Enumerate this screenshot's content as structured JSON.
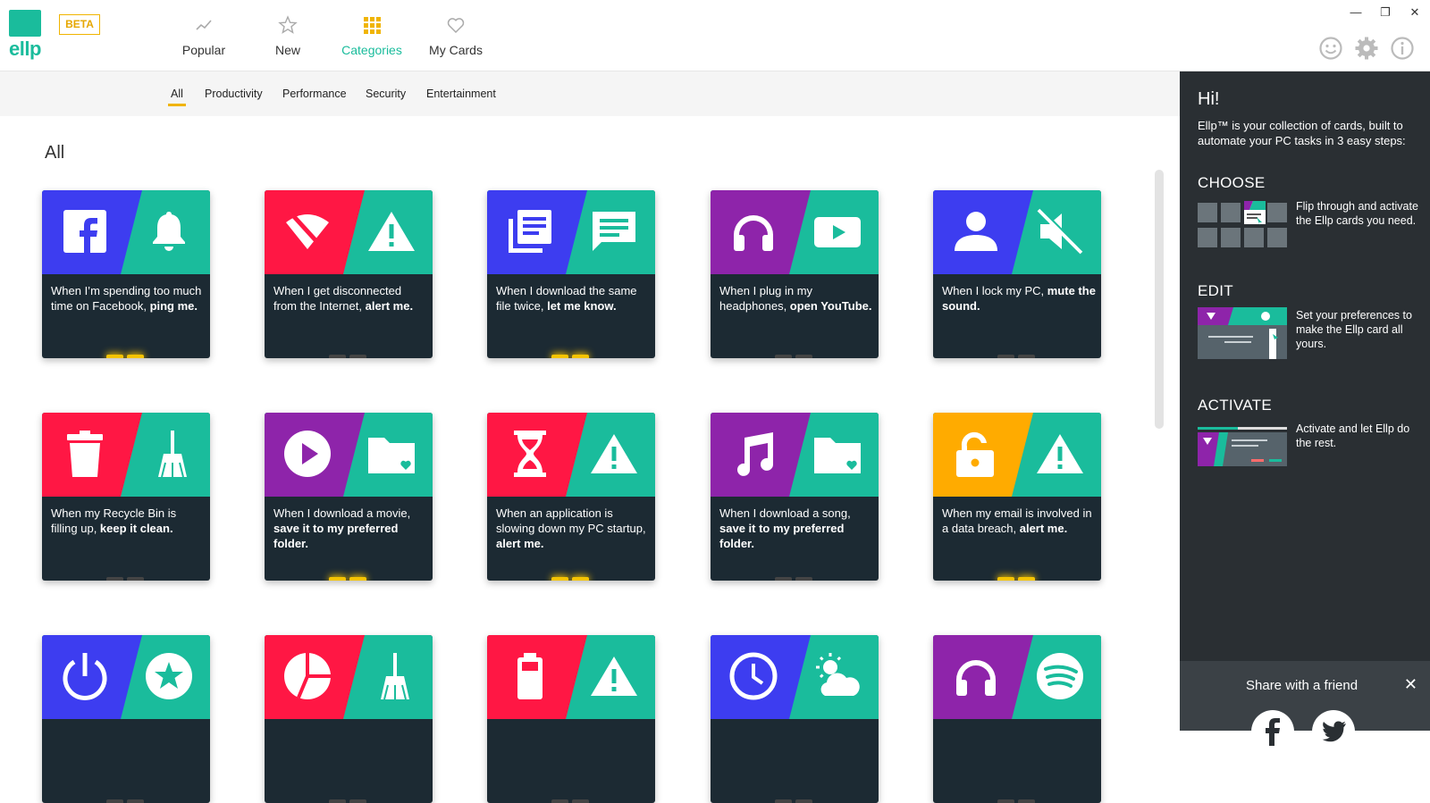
{
  "app": {
    "logo_text": "ellp",
    "beta_label": "BETA"
  },
  "nav": {
    "items": [
      {
        "label": "Popular",
        "icon": "trend-icon"
      },
      {
        "label": "New",
        "icon": "star-icon"
      },
      {
        "label": "Categories",
        "icon": "grid-icon",
        "active": true
      },
      {
        "label": "My Cards",
        "icon": "heart-icon"
      }
    ]
  },
  "window_controls": [
    "minimize",
    "restore",
    "close"
  ],
  "top_icons": [
    "smiley-icon",
    "gear-icon",
    "info-icon"
  ],
  "subnav": {
    "items": [
      {
        "label": "All",
        "active": true
      },
      {
        "label": "Productivity"
      },
      {
        "label": "Performance"
      },
      {
        "label": "Security"
      },
      {
        "label": "Entertainment"
      }
    ]
  },
  "section_title": "All",
  "colors": {
    "teal": "#1abc9c",
    "blue": "#3d3df0",
    "red": "#ff1744",
    "purple": "#8e24aa",
    "orange": "#ffab00",
    "card_dark": "#1c2a33",
    "yellow": "#f5c400"
  },
  "cards": [
    {
      "left_color": "#3d3df0",
      "left_icon": "facebook-icon",
      "right_icon": "bell-icon",
      "text_plain": "When I’m spending too much time on Facebook, ",
      "text_bold": "ping me.",
      "toggle_on": true
    },
    {
      "left_color": "#ff1744",
      "left_icon": "no-wifi-icon",
      "right_icon": "warning-icon",
      "text_plain": "When I get disconnected from the Internet, ",
      "text_bold": "alert me.",
      "toggle_on": false
    },
    {
      "left_color": "#3d3df0",
      "left_icon": "documents-icon",
      "right_icon": "message-icon",
      "text_plain": "When I download the same file twice, ",
      "text_bold": "let me know.",
      "toggle_on": true
    },
    {
      "left_color": "#8e24aa",
      "left_icon": "headphones-icon",
      "right_icon": "youtube-icon",
      "text_plain": "When I plug in my headphones, ",
      "text_bold": "open YouTube.",
      "toggle_on": false
    },
    {
      "left_color": "#3d3df0",
      "left_icon": "user-icon",
      "right_icon": "mute-icon",
      "text_plain": "When I lock my PC, ",
      "text_bold": "mute the sound.",
      "toggle_on": false
    },
    {
      "left_color": "#ff1744",
      "left_icon": "trash-icon",
      "right_icon": "broom-icon",
      "text_plain": "When my Recycle Bin is filling up, ",
      "text_bold": "keep it clean.",
      "toggle_on": false
    },
    {
      "left_color": "#8e24aa",
      "left_icon": "play-icon",
      "right_icon": "folder-heart-icon",
      "text_plain": "When I download a movie, ",
      "text_bold": "save it to my preferred folder.",
      "toggle_on": true
    },
    {
      "left_color": "#ff1744",
      "left_icon": "hourglass-icon",
      "right_icon": "warning-icon",
      "text_plain": "When an application is slowing down my PC startup, ",
      "text_bold": "alert me.",
      "toggle_on": true
    },
    {
      "left_color": "#8e24aa",
      "left_icon": "music-icon",
      "right_icon": "folder-heart-icon",
      "text_plain": "When I download a song, ",
      "text_bold": "save it to my preferred folder.",
      "toggle_on": false
    },
    {
      "left_color": "#ffab00",
      "left_icon": "unlock-icon",
      "right_icon": "warning-icon",
      "text_plain": "When my email is involved in a data breach, ",
      "text_bold": "alert me.",
      "toggle_on": true
    },
    {
      "left_color": "#3d3df0",
      "left_icon": "power-icon",
      "right_icon": "star-badge-icon",
      "text_plain": "",
      "text_bold": "",
      "toggle_on": false
    },
    {
      "left_color": "#ff1744",
      "left_icon": "pie-chart-icon",
      "right_icon": "broom-icon",
      "text_plain": "",
      "text_bold": "",
      "toggle_on": false
    },
    {
      "left_color": "#ff1744",
      "left_icon": "battery-icon",
      "right_icon": "warning-icon",
      "text_plain": "",
      "text_bold": "",
      "toggle_on": false
    },
    {
      "left_color": "#3d3df0",
      "left_icon": "clock-icon",
      "right_icon": "weather-icon",
      "text_plain": "",
      "text_bold": "",
      "toggle_on": false
    },
    {
      "left_color": "#8e24aa",
      "left_icon": "headphones-icon",
      "right_icon": "spotify-icon",
      "text_plain": "",
      "text_bold": "",
      "toggle_on": false
    }
  ],
  "panel": {
    "greeting": "Hi!",
    "intro": "Ellp™ is your collection of cards, built to automate your PC tasks in 3 easy steps:",
    "steps": [
      {
        "title": "CHOOSE",
        "text": "Flip through and activate the Ellp cards you need."
      },
      {
        "title": "EDIT",
        "text": "Set your preferences to make the Ellp card all yours."
      },
      {
        "title": "ACTIVATE",
        "text": "Activate and let Ellp do the rest."
      }
    ]
  },
  "share": {
    "title": "Share with a friend",
    "close_label": "✕",
    "networks": [
      "facebook-icon",
      "twitter-icon"
    ]
  }
}
